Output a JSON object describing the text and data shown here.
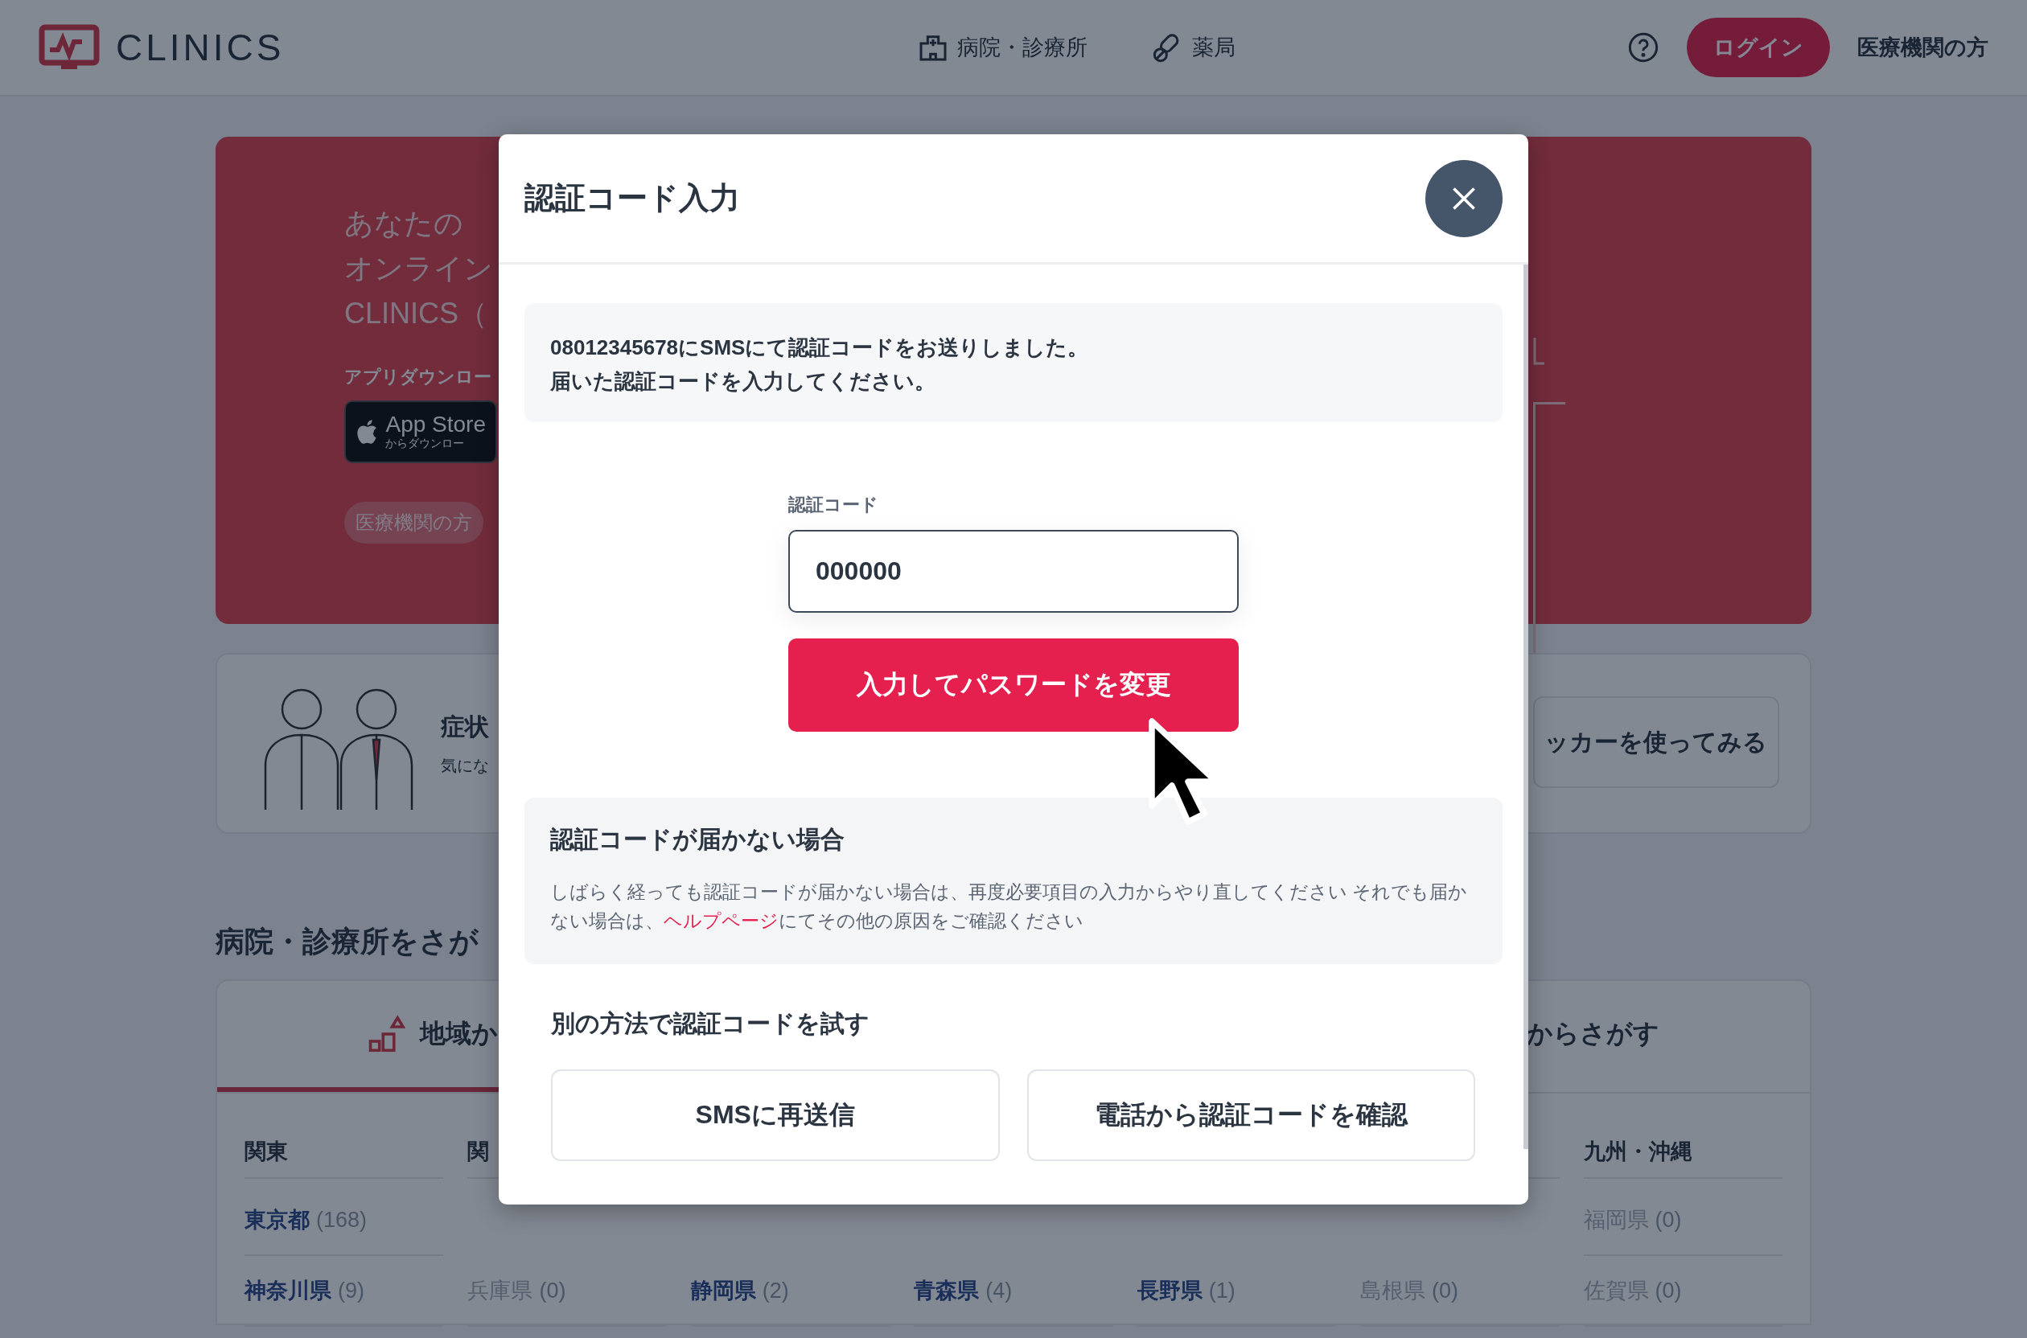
{
  "header": {
    "logo": "CLINICS",
    "nav": [
      {
        "label": "病院・診療所",
        "kind": "clinic"
      },
      {
        "label": "薬局",
        "kind": "pharmacy"
      }
    ],
    "login": "ログイン",
    "for_institutions": "医療機関の方"
  },
  "hero": {
    "lines": [
      "あなたの",
      "オンライン",
      "CLINICS（"
    ],
    "download_label": "アプリダウンロー",
    "app_store": {
      "title": "App Store",
      "subtitle": "からダウンロー"
    },
    "chip": "医療機関の方"
  },
  "symptom_card": {
    "title": "症状",
    "subtitle": "気にな",
    "button": "ッカーを使ってみる"
  },
  "search": {
    "title": "病院・診療所をさが",
    "tabs": [
      {
        "label": "地域か",
        "kind": "area",
        "selected": true
      },
      {
        "label": "からさがす",
        "kind": "station",
        "selected": false
      }
    ],
    "columns": [
      {
        "heading": "関東",
        "prefectures": [
          {
            "name": "東京都",
            "count": "(168)",
            "disabled": false
          },
          {
            "name": "神奈川県",
            "count": "(9)",
            "disabled": false
          }
        ]
      },
      {
        "heading": "関",
        "prefectures": [
          {
            "name": "兵庫県",
            "count": "(0)",
            "disabled": true
          }
        ]
      },
      {
        "prefectures": [
          {
            "name": "静岡県",
            "count": "(2)",
            "disabled": false
          }
        ]
      },
      {
        "prefectures": [
          {
            "name": "青森県",
            "count": "(4)",
            "disabled": false
          }
        ]
      },
      {
        "prefectures": [
          {
            "name": "長野県",
            "count": "(1)",
            "disabled": false
          }
        ]
      },
      {
        "prefectures": [
          {
            "name": "島根県",
            "count": "(0)",
            "disabled": true
          }
        ]
      },
      {
        "heading": "九州・沖縄",
        "prefectures": [
          {
            "name": "福岡県",
            "count": "(0)",
            "disabled": true
          },
          {
            "name": "佐賀県",
            "count": "(0)",
            "disabled": true
          }
        ]
      }
    ]
  },
  "modal": {
    "title": "認証コード入力",
    "message": [
      "08012345678にSMSにて認証コードをお送りしました。",
      "届いた認証コードを入力してください。"
    ],
    "code_field": {
      "label": "認証コード",
      "value": "000000"
    },
    "submit": "入力してパスワードを変更",
    "help": {
      "title": "認証コードが届かない場合",
      "text_before": "しばらく経っても認証コードが届かない場合は、再度必要項目の入力からやり直してください それでも届かない場合は、",
      "link": "ヘルプページ",
      "text_after": "にてその他の原因をご確認ください"
    },
    "alternatives": {
      "title": "別の方法で認証コードを試す",
      "buttons": [
        "SMSに再送信",
        "電話から認証コードを確認"
      ]
    }
  }
}
